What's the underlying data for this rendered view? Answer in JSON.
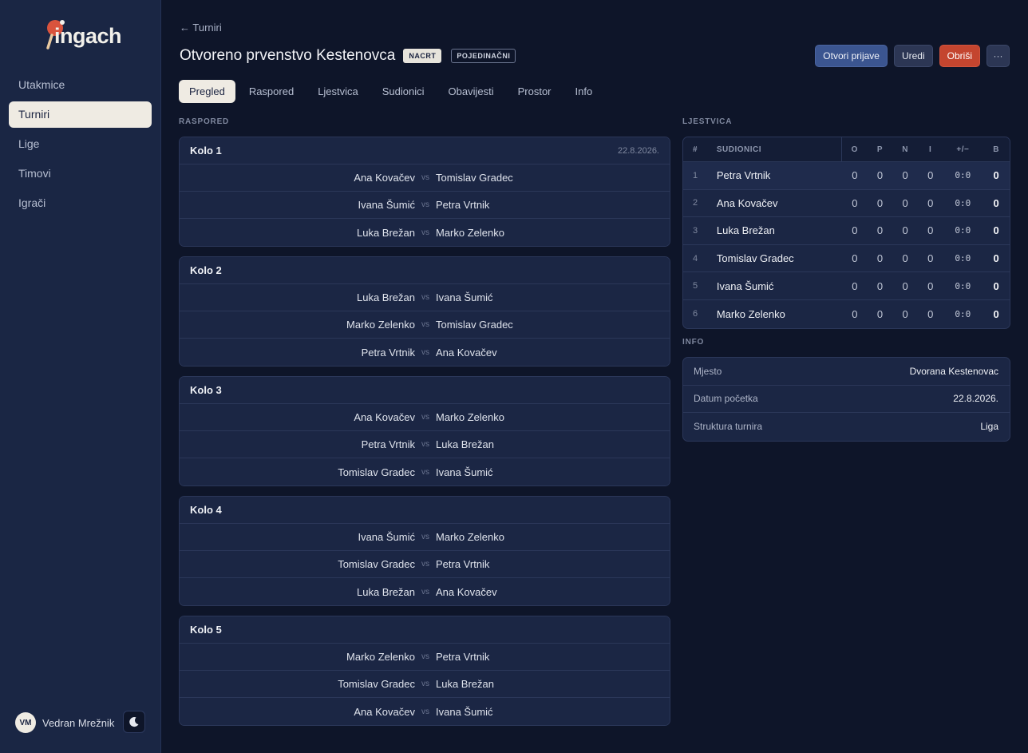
{
  "app": {
    "logo_text": "ingach"
  },
  "sidebar": {
    "items": [
      {
        "label": "Utakmice",
        "active": false
      },
      {
        "label": "Turniri",
        "active": true
      },
      {
        "label": "Lige",
        "active": false
      },
      {
        "label": "Timovi",
        "active": false
      },
      {
        "label": "Igrači",
        "active": false
      }
    ],
    "user": {
      "initials": "VM",
      "name": "Vedran Mrežnik"
    },
    "theme_icon": "moon-icon"
  },
  "header": {
    "back_label": "← Turniri",
    "title": "Otvoreno prvenstvo Kestenovca",
    "status_badge": "NACRT",
    "type_badge": "POJEDINAČNI",
    "actions": {
      "open_registrations": "Otvori prijave",
      "edit": "Uredi",
      "delete": "Obriši",
      "more": "···"
    }
  },
  "tabs": [
    {
      "label": "Pregled",
      "active": true
    },
    {
      "label": "Raspored",
      "active": false
    },
    {
      "label": "Ljestvica",
      "active": false
    },
    {
      "label": "Sudionici",
      "active": false
    },
    {
      "label": "Obavijesti",
      "active": false
    },
    {
      "label": "Prostor",
      "active": false
    },
    {
      "label": "Info",
      "active": false
    }
  ],
  "schedule": {
    "label": "RASPORED",
    "vs_label": "vs",
    "rounds": [
      {
        "name": "Kolo 1",
        "date": "22.8.2026.",
        "matches": [
          {
            "home": "Ana Kovačev",
            "away": "Tomislav Gradec"
          },
          {
            "home": "Ivana Šumić",
            "away": "Petra Vrtnik"
          },
          {
            "home": "Luka Brežan",
            "away": "Marko Zelenko"
          }
        ]
      },
      {
        "name": "Kolo 2",
        "date": "",
        "matches": [
          {
            "home": "Luka Brežan",
            "away": "Ivana Šumić"
          },
          {
            "home": "Marko Zelenko",
            "away": "Tomislav Gradec"
          },
          {
            "home": "Petra Vrtnik",
            "away": "Ana Kovačev"
          }
        ]
      },
      {
        "name": "Kolo 3",
        "date": "",
        "matches": [
          {
            "home": "Ana Kovačev",
            "away": "Marko Zelenko"
          },
          {
            "home": "Petra Vrtnik",
            "away": "Luka Brežan"
          },
          {
            "home": "Tomislav Gradec",
            "away": "Ivana Šumić"
          }
        ]
      },
      {
        "name": "Kolo 4",
        "date": "",
        "matches": [
          {
            "home": "Ivana Šumić",
            "away": "Marko Zelenko"
          },
          {
            "home": "Tomislav Gradec",
            "away": "Petra Vrtnik"
          },
          {
            "home": "Luka Brežan",
            "away": "Ana Kovačev"
          }
        ]
      },
      {
        "name": "Kolo 5",
        "date": "",
        "matches": [
          {
            "home": "Marko Zelenko",
            "away": "Petra Vrtnik"
          },
          {
            "home": "Tomislav Gradec",
            "away": "Luka Brežan"
          },
          {
            "home": "Ana Kovačev",
            "away": "Ivana Šumić"
          }
        ]
      }
    ]
  },
  "standings": {
    "label": "LJESTVICA",
    "columns": {
      "rank": "#",
      "name": "SUDIONICI",
      "o": "O",
      "p": "P",
      "n": "N",
      "i": "I",
      "diff": "+/−",
      "b": "B"
    },
    "rows": [
      {
        "rank": "1",
        "name": "Petra Vrtnik",
        "o": "0",
        "p": "0",
        "n": "0",
        "i": "0",
        "diff": "0:0",
        "b": "0"
      },
      {
        "rank": "2",
        "name": "Ana Kovačev",
        "o": "0",
        "p": "0",
        "n": "0",
        "i": "0",
        "diff": "0:0",
        "b": "0"
      },
      {
        "rank": "3",
        "name": "Luka Brežan",
        "o": "0",
        "p": "0",
        "n": "0",
        "i": "0",
        "diff": "0:0",
        "b": "0"
      },
      {
        "rank": "4",
        "name": "Tomislav Gradec",
        "o": "0",
        "p": "0",
        "n": "0",
        "i": "0",
        "diff": "0:0",
        "b": "0"
      },
      {
        "rank": "5",
        "name": "Ivana Šumić",
        "o": "0",
        "p": "0",
        "n": "0",
        "i": "0",
        "diff": "0:0",
        "b": "0"
      },
      {
        "rank": "6",
        "name": "Marko Zelenko",
        "o": "0",
        "p": "0",
        "n": "0",
        "i": "0",
        "diff": "0:0",
        "b": "0"
      }
    ]
  },
  "info": {
    "label": "INFO",
    "rows": [
      {
        "key": "Mjesto",
        "value": "Dvorana Kestenovac"
      },
      {
        "key": "Datum početka",
        "value": "22.8.2026."
      },
      {
        "key": "Struktura turnira",
        "value": "Liga"
      }
    ]
  },
  "colors": {
    "background": "#0e1529",
    "sidebar": "#1a2644",
    "accent_primary": "#3b5590",
    "danger": "#c4452f",
    "active_pill": "#efebe3",
    "paddle_red": "#d9533d"
  }
}
